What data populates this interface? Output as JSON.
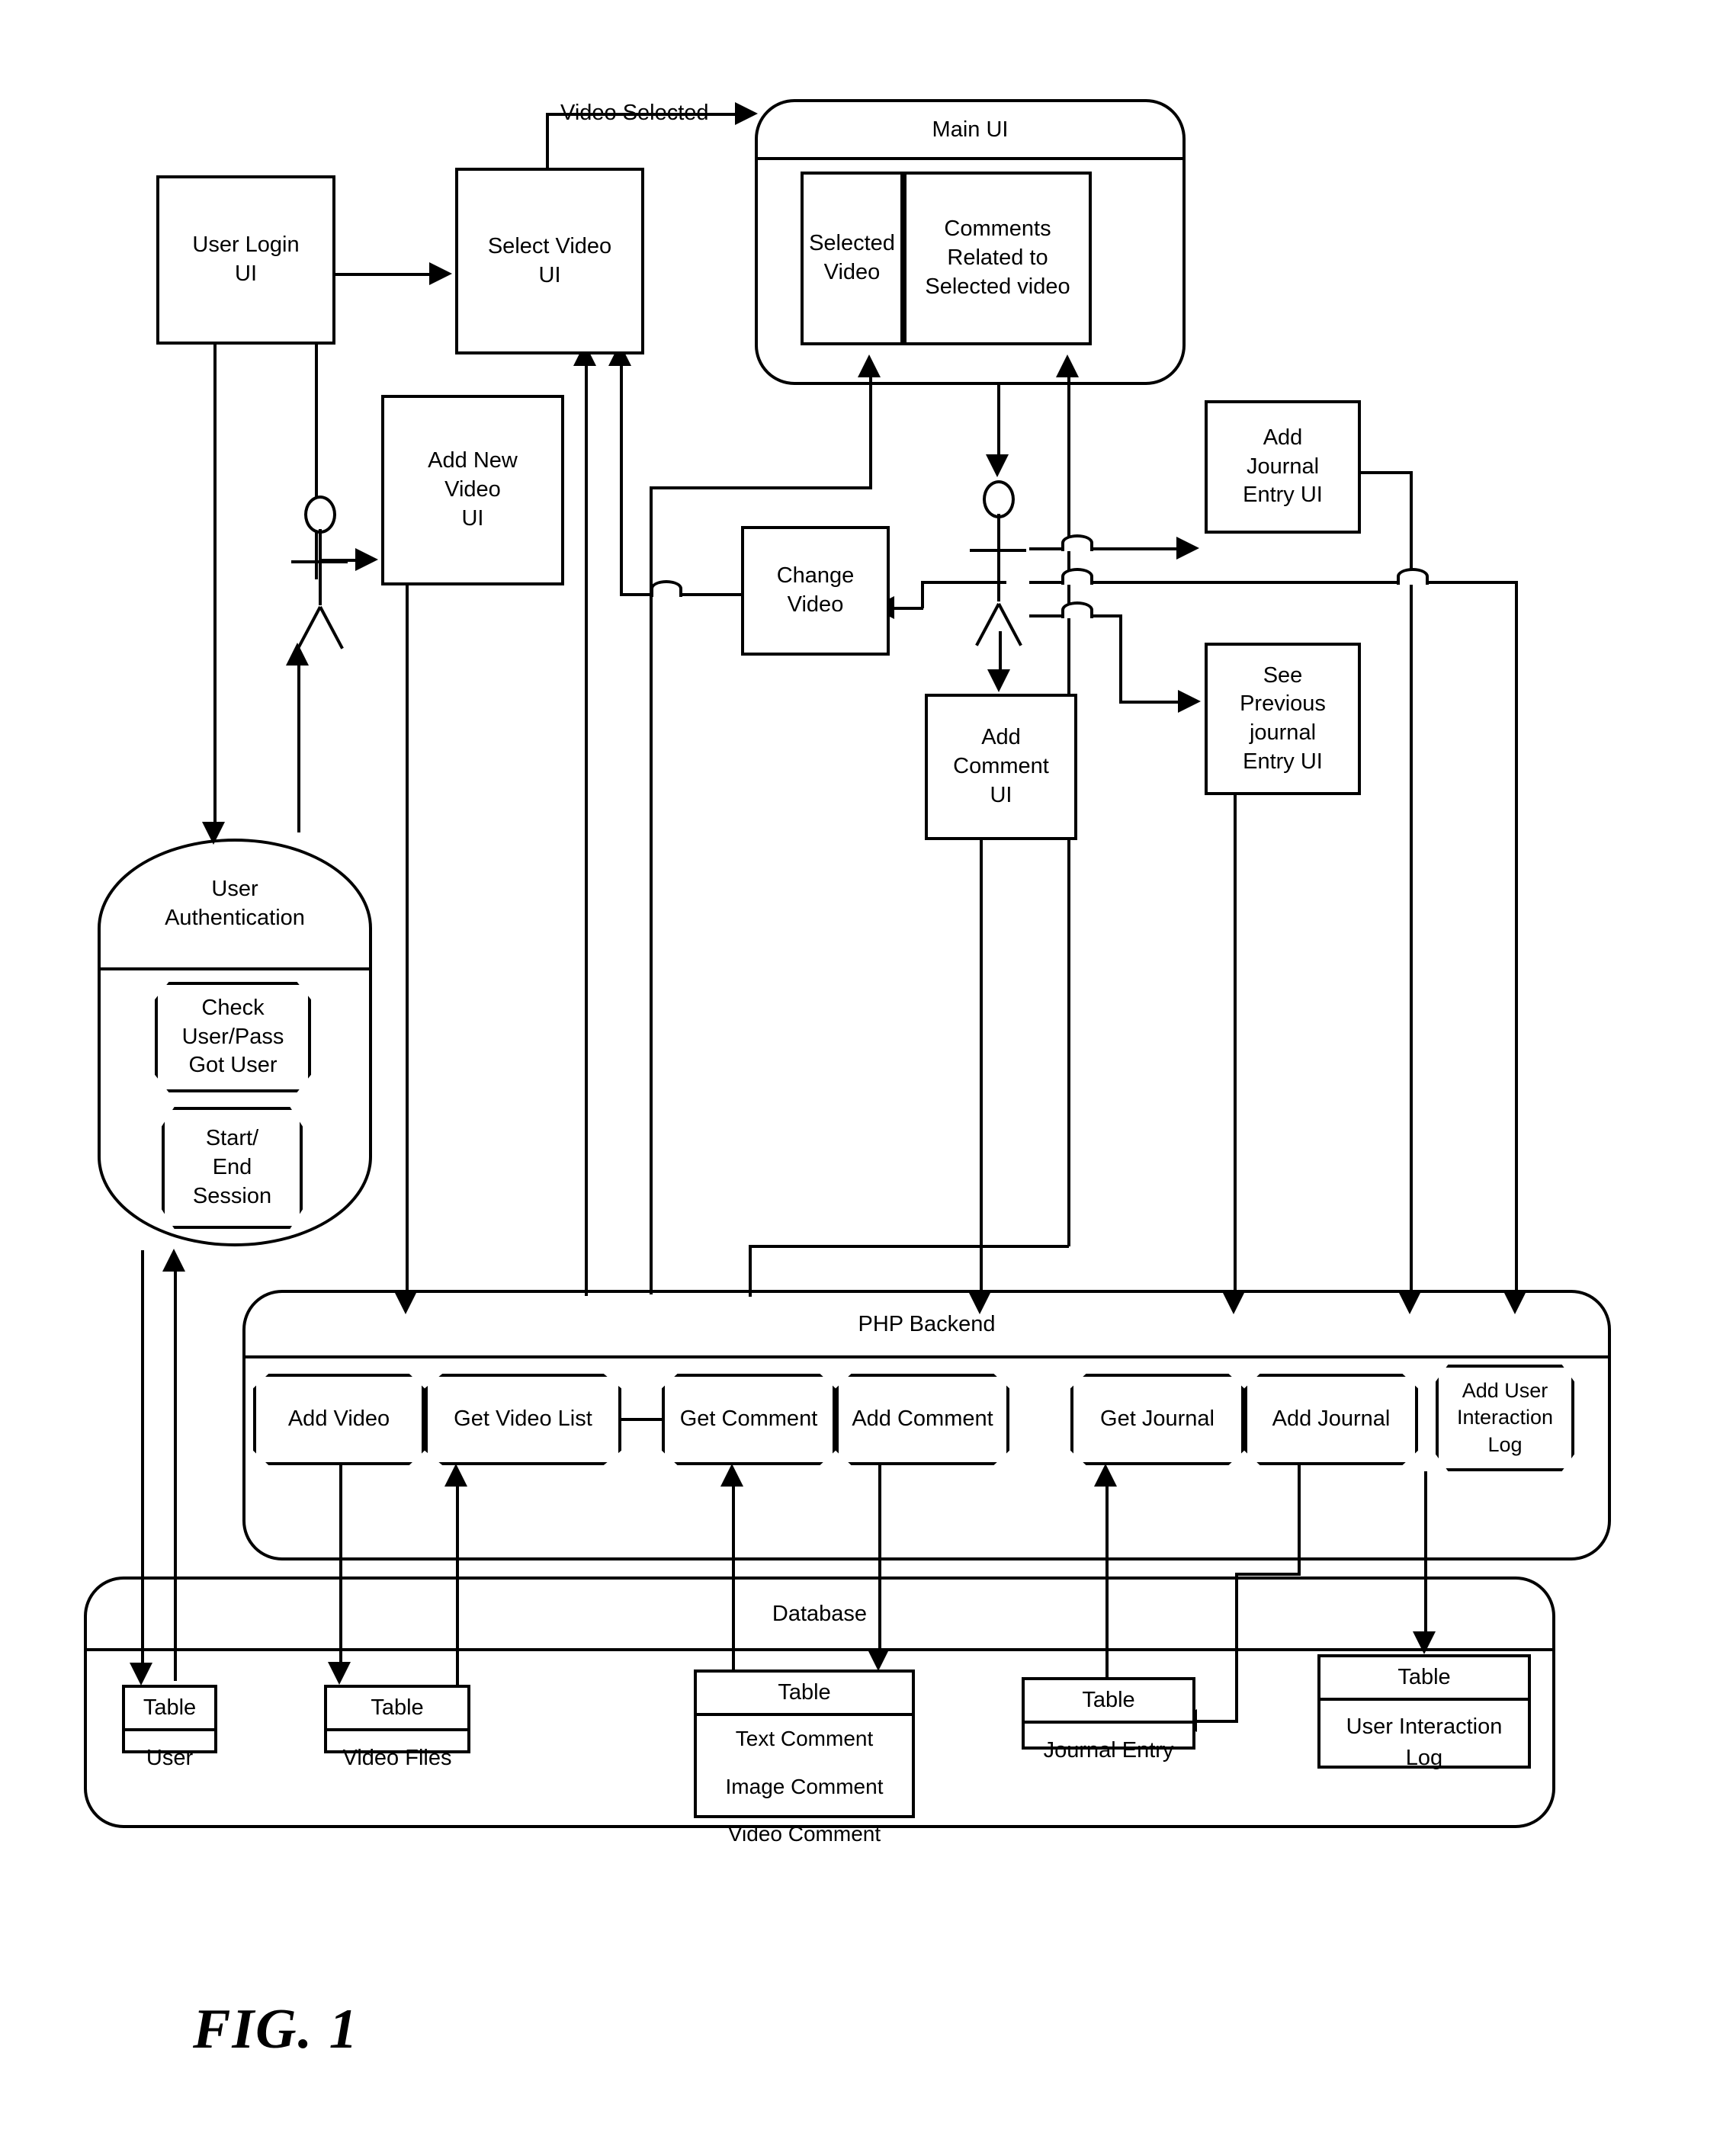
{
  "figure": {
    "caption": "FIG. 1",
    "edge_label_video_selected": "Video Selected"
  },
  "ui_boxes": {
    "user_login": "User Login\nUI",
    "select_video": "Select Video\nUI",
    "add_new_video": "Add New\nVideo\nUI",
    "change_video": "Change\nVideo",
    "add_comment_ui": "Add\nComment\nUI",
    "add_journal_entry_ui": "Add\nJournal\nEntry UI",
    "see_previous_journal_entry_ui": "See\nPrevious\njournal\nEntry UI"
  },
  "main_ui": {
    "title": "Main UI",
    "panes": [
      {
        "label": "Selected\nVideo"
      },
      {
        "label": "Comments\nRelated to\nSelected video"
      }
    ]
  },
  "authentication": {
    "title": "User\nAuthentication",
    "operations": [
      {
        "label": "Check\nUser/Pass\nGot User"
      },
      {
        "label": "Start/\nEnd\nSession"
      }
    ]
  },
  "php_backend": {
    "title": "PHP Backend",
    "operations": [
      {
        "label": "Add Video"
      },
      {
        "label": "Get Video List"
      },
      {
        "label": "Get Comment"
      },
      {
        "label": "Add Comment"
      },
      {
        "label": "Get Journal"
      },
      {
        "label": "Add Journal"
      },
      {
        "label": "Add User\nInteraction\nLog"
      }
    ]
  },
  "database": {
    "title": "Database",
    "tables": [
      {
        "header": "Table",
        "body": "User"
      },
      {
        "header": "Table",
        "body": "Video Files"
      },
      {
        "header": "Table",
        "body": "Text Comment\n\nImage Comment\n\nVideo Comment"
      },
      {
        "header": "Table",
        "body": "Journal Entry"
      },
      {
        "header": "Table",
        "body": "User Interaction\nLog"
      }
    ]
  },
  "actors": [
    {
      "name": "primary-user-actor"
    },
    {
      "name": "secondary-user-actor"
    }
  ],
  "colors": {
    "stroke": "#000000",
    "fill": "#ffffff"
  }
}
